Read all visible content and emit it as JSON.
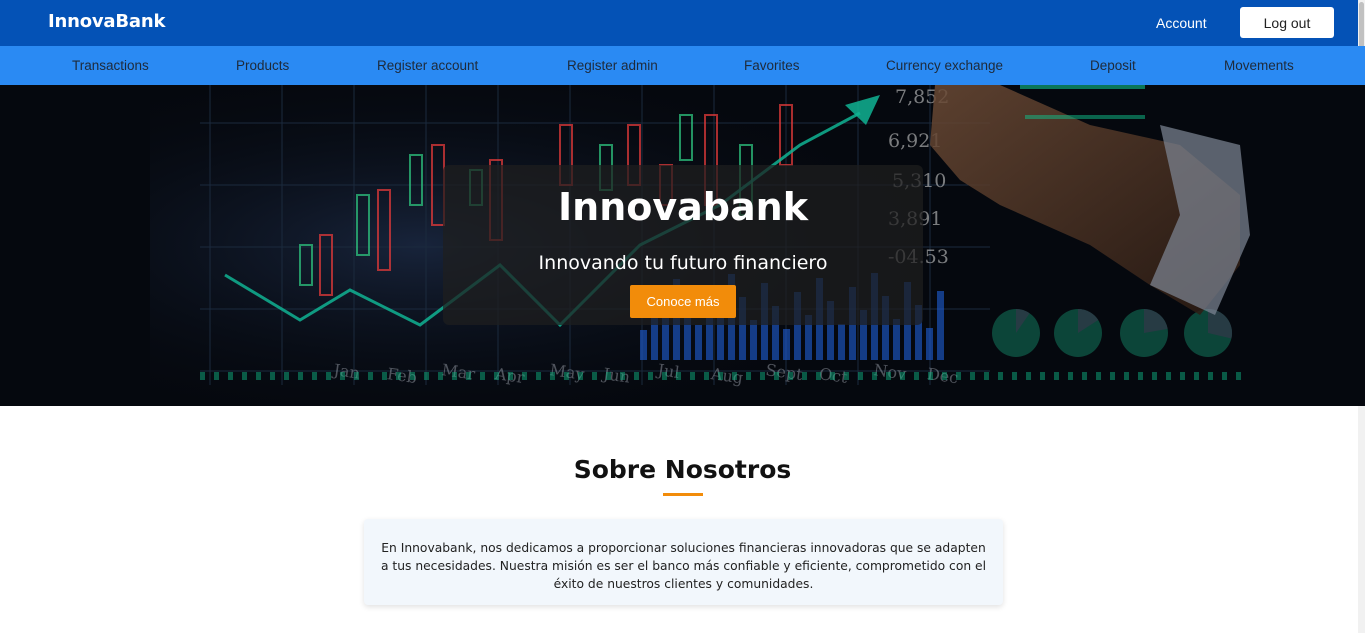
{
  "header": {
    "brand": "InnovaBank",
    "account_label": "Account",
    "logout_label": "Log out",
    "bg_color": "#0452b6"
  },
  "nav": {
    "bg_color": "#2a8af3",
    "items": [
      {
        "label": "Transactions"
      },
      {
        "label": "Products"
      },
      {
        "label": "Register account"
      },
      {
        "label": "Register admin"
      },
      {
        "label": "Favorites"
      },
      {
        "label": "Currency exchange"
      },
      {
        "label": "Deposit"
      },
      {
        "label": "Movements"
      }
    ]
  },
  "hero": {
    "title": "Innovabank",
    "subtitle": "Innovando tu futuro financiero",
    "cta_label": "Conoce más",
    "cta_color": "#f28c0a",
    "background_numbers": [
      "7,852",
      "6,921",
      "5,310",
      "3,891",
      "-04.53"
    ],
    "background_months": [
      "Jan",
      "Feb",
      "Mar",
      "Apr",
      "May",
      "Jun",
      "Jul",
      "Aug",
      "Sept",
      "Oct",
      "Nov",
      "Dec"
    ]
  },
  "about": {
    "title": "Sobre Nosotros",
    "text": "En Innovabank, nos dedicamos a proporcionar soluciones financieras innovadoras que se adapten a tus necesidades. Nuestra misión es ser el banco más confiable y eficiente, comprometido con el éxito de nuestros clientes y comunidades."
  }
}
